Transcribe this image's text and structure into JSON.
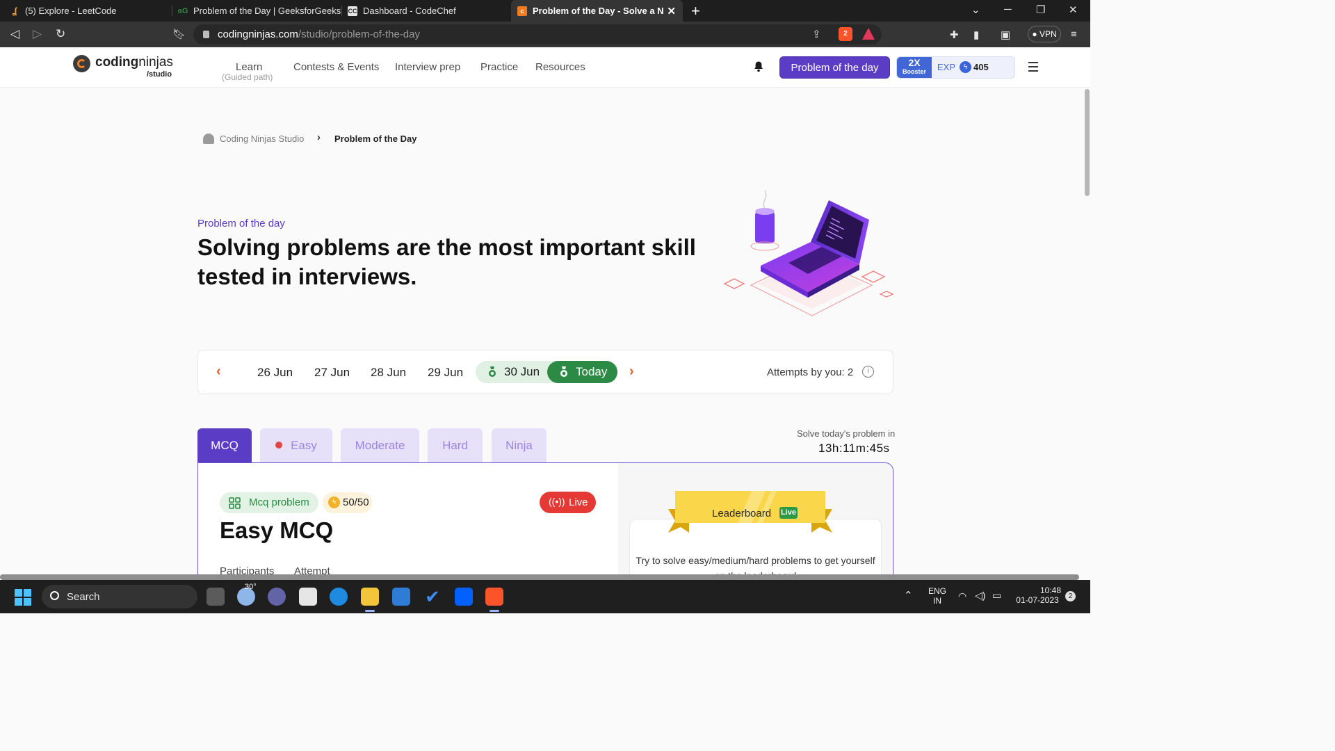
{
  "browser": {
    "tabs": [
      {
        "label": "(5) Explore - LeetCode",
        "favicon": "leetcode-icon"
      },
      {
        "label": "Problem of the Day | GeeksforGeeks | A",
        "favicon": "gfg-icon"
      },
      {
        "label": "Dashboard - CodeChef",
        "favicon": "codechef-icon"
      },
      {
        "label": "Problem of the Day - Solve a New",
        "favicon": "codingninjas-icon"
      }
    ],
    "url_host": "codingninjas.com",
    "url_path": "/studio/problem-of-the-day",
    "brave_count": "2",
    "vpn_label": "VPN"
  },
  "header": {
    "logo_word1": "coding",
    "logo_word2": "ninjas",
    "logo_sub": "/studio",
    "nav": [
      {
        "label": "Learn",
        "sub": "(Guided path)"
      },
      {
        "label": "Contests & Events"
      },
      {
        "label": "Interview prep"
      },
      {
        "label": "Practice"
      },
      {
        "label": "Resources"
      }
    ],
    "potd_button": "Problem of the day",
    "booster_x": "2X",
    "booster_label": "Booster",
    "exp_label": "EXP",
    "exp_value": "405"
  },
  "breadcrumb": {
    "root": "Coding Ninjas Studio",
    "current": "Problem of the Day"
  },
  "hero": {
    "kicker": "Problem of the day",
    "title": "Solving problems are the most important skill tested in interviews."
  },
  "dates": {
    "items": [
      "26 Jun",
      "27 Jun",
      "28 Jun",
      "29 Jun",
      "30 Jun"
    ],
    "today": "Today",
    "attempts": "Attempts by you: 2"
  },
  "tabs": {
    "items": [
      "MCQ",
      "Easy",
      "Moderate",
      "Hard",
      "Ninja"
    ],
    "solve_label": "Solve today's problem in",
    "timer": "13h:11m:45s"
  },
  "card": {
    "type_chip": "Mcq problem",
    "score": "50/50",
    "live": "Live",
    "title": "Easy MCQ",
    "col1": "Participants",
    "col2": "Attempt",
    "leaderboard": "Leaderboard",
    "leaderboard_badge": "Live",
    "leaderboard_desc": "Try to solve easy/medium/hard problems to get yourself on the leaderboard"
  },
  "taskbar": {
    "search": "Search",
    "weather": "30°",
    "lang1": "ENG",
    "lang2": "IN",
    "time": "10:48",
    "date": "01-07-2023",
    "notifications": "2"
  },
  "colors": {
    "brand_purple": "#5b3cc4",
    "today_green": "#2c8a44",
    "live_red": "#e53935",
    "chevron_orange": "#e05a2b"
  }
}
